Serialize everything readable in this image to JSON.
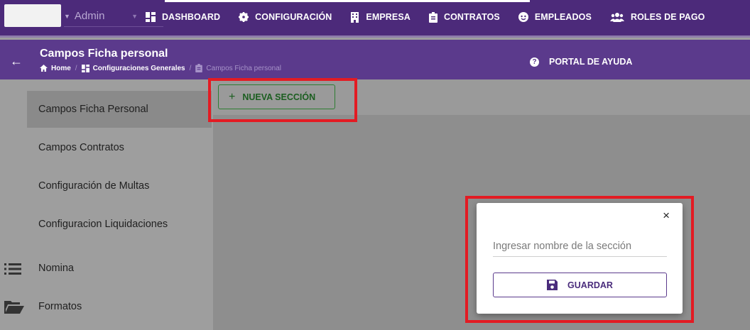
{
  "topnav": {
    "user_label": "Admin",
    "items": [
      {
        "label": "DASHBOARD",
        "icon": "dashboard-icon"
      },
      {
        "label": "CONFIGURACIÓN",
        "icon": "gear-icon"
      },
      {
        "label": "EMPRESA",
        "icon": "building-icon"
      },
      {
        "label": "CONTRATOS",
        "icon": "clipboard-icon"
      },
      {
        "label": "EMPLEADOS",
        "icon": "face-icon"
      },
      {
        "label": "ROLES DE PAGO",
        "icon": "users-icon"
      }
    ]
  },
  "header": {
    "title": "Campos Ficha personal",
    "breadcrumb": {
      "home": "Home",
      "parent": "Configuraciones Generales",
      "current": "Campos Ficha personal"
    },
    "help_label": "PORTAL DE AYUDA"
  },
  "sidebar": {
    "items": [
      {
        "label": "Campos Ficha Personal"
      },
      {
        "label": "Campos Contratos"
      },
      {
        "label": "Configuración de Multas"
      },
      {
        "label": "Configuracion Liquidaciones"
      },
      {
        "label": "Nomina",
        "icon": "list-icon"
      },
      {
        "label": "Formatos",
        "icon": "folder-icon"
      }
    ]
  },
  "main": {
    "new_section_label": "NUEVA SECCIÓN"
  },
  "dialog": {
    "close_symbol": "×",
    "input_placeholder": "Ingresar nombre de la sección",
    "save_label": "GUARDAR"
  },
  "colors": {
    "nav_bg": "#4c2a7a",
    "subheader_bg": "#5b3a8c",
    "highlight": "#e31b23",
    "success": "#2e7d32"
  }
}
